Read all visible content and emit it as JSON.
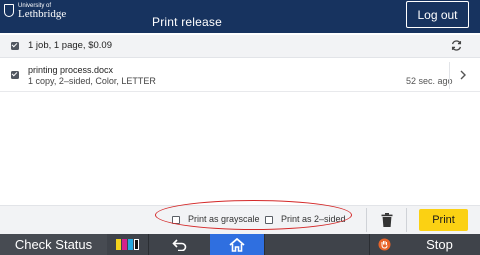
{
  "header": {
    "logo_line1": "University of",
    "logo_line2": "Lethbridge",
    "title": "Print release",
    "logout_label": "Log out"
  },
  "summary": {
    "text": "1 job, 1 page, $0.09",
    "selected": true
  },
  "jobs": [
    {
      "name": "printing process.docx",
      "details": "1 copy, 2–sided, Color, LETTER",
      "time": "52 sec. ago",
      "selected": true
    }
  ],
  "options": {
    "grayscale_label": "Print as grayscale",
    "twosided_label": "Print as 2–sided",
    "grayscale_checked": false,
    "twosided_checked": false
  },
  "actions": {
    "print_label": "Print"
  },
  "system_bar": {
    "check_status_label": "Check Status",
    "stop_label": "Stop"
  },
  "colors": {
    "header_bg": "#17335f",
    "print_button": "#fbd113",
    "home_button": "#2f6fe0",
    "annotation_oval": "#d42a2a",
    "toner_yellow": "#f3d21d",
    "toner_magenta": "#d4228c",
    "toner_cyan": "#25a8e0",
    "toner_black": "#111111",
    "stop_icon": "#e8642a"
  },
  "icons": {
    "logo": "shield-crest",
    "refresh": "refresh-icon",
    "row_chevron": "chevron-right-icon",
    "delete": "trash-icon",
    "toner": "toner-icon",
    "back": "back-arrow-icon",
    "home": "home-icon",
    "stop": "stop-hand-icon"
  }
}
